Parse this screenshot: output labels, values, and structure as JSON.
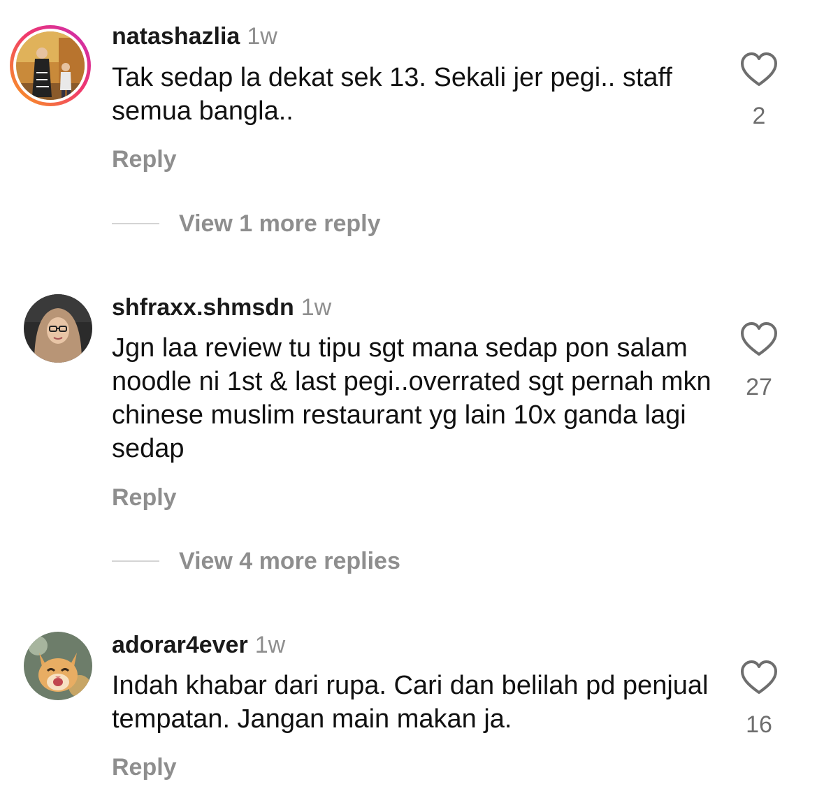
{
  "comments": [
    {
      "username": "natashazlia",
      "time": "1w",
      "text": "Tak sedap la dekat sek 13. Sekali jer pegi.. staff semua bangla..",
      "likes": "2",
      "reply_label": "Reply",
      "more_replies": "View 1 more reply",
      "avatar_icon": "avatar-photo-family",
      "has_story_ring": true
    },
    {
      "username": "shfraxx.shmsdn",
      "time": "1w",
      "text": "Jgn laa review tu tipu sgt mana sedap pon salam noodle ni 1st & last pegi..overrated sgt  pernah mkn chinese muslim restaurant yg lain 10x ganda lagi sedap",
      "likes": "27",
      "reply_label": "Reply",
      "more_replies": "View 4 more replies",
      "avatar_icon": "avatar-photo-woman-hijab",
      "has_story_ring": false
    },
    {
      "username": "adorar4ever",
      "time": "1w",
      "text": "Indah khabar dari rupa. Cari dan belilah pd penjual tempatan. Jangan main makan ja.",
      "likes": "16",
      "reply_label": "Reply",
      "avatar_icon": "avatar-photo-cat",
      "has_story_ring": false
    }
  ],
  "colors": {
    "username": "#1a1a1a",
    "secondary_text": "#8e8e8e",
    "divider": "#d4d4d4",
    "story_ring_start": "#f9a11b",
    "story_ring_end": "#e1306c"
  },
  "icons": {
    "like": "heart-outline-icon"
  }
}
